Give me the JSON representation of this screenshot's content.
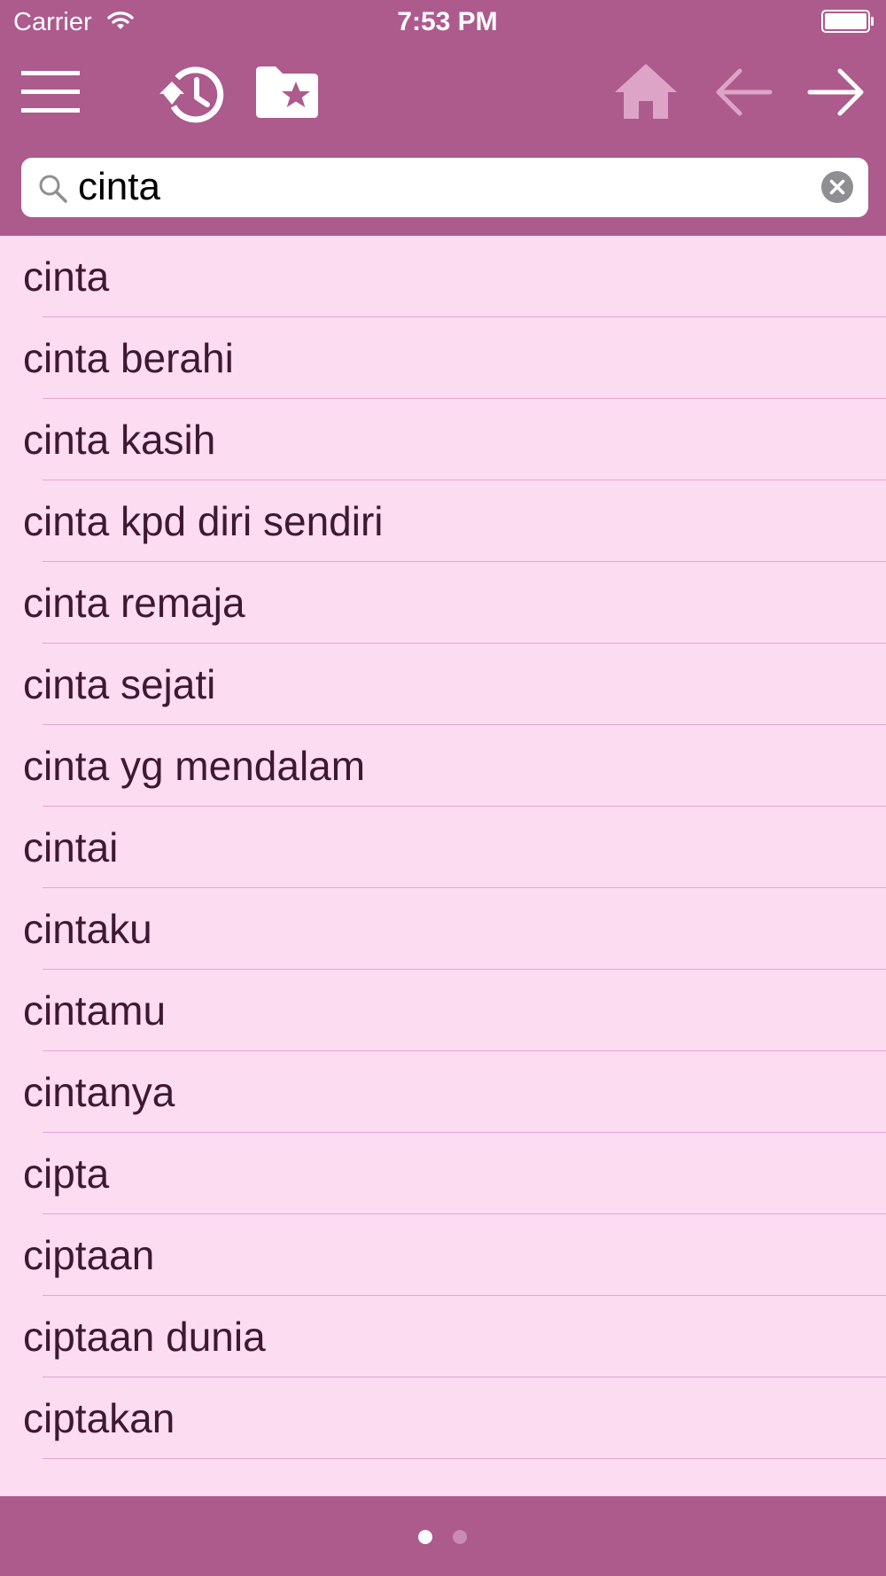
{
  "status_bar": {
    "carrier": "Carrier",
    "time": "7:53 PM"
  },
  "toolbar": {
    "icons": [
      "menu-icon",
      "history-icon",
      "favorites-folder-icon",
      "home-icon",
      "back-arrow-icon",
      "forward-arrow-icon"
    ]
  },
  "search": {
    "value": "cinta",
    "placeholder": ""
  },
  "results": [
    "cinta",
    "cinta berahi",
    "cinta kasih",
    "cinta kpd diri sendiri",
    "cinta remaja",
    "cinta sejati",
    "cinta yg mendalam",
    "cintai",
    "cintaku",
    "cintamu",
    "cintanya",
    "cipta",
    "ciptaan",
    "ciptaan dunia",
    "ciptakan"
  ],
  "pagination": {
    "page_count": 2,
    "active_page": 1
  },
  "colors": {
    "bar": "#ad5a8d",
    "list_background": "#fcdcf1",
    "row_text": "#3f1832",
    "separator": "#e6a6d4",
    "disabled_icon": "#dda4c7"
  }
}
